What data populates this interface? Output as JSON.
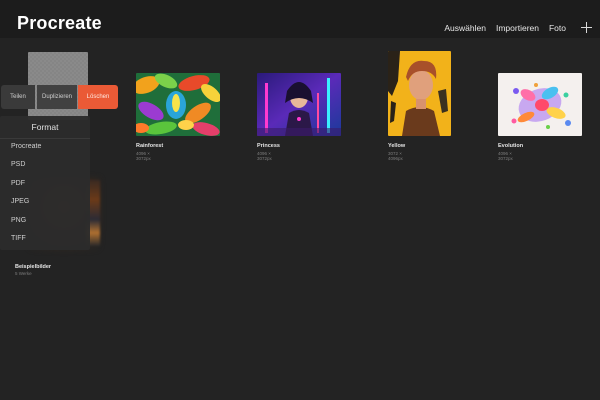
{
  "app": {
    "title": "Procreate"
  },
  "topnav": {
    "select": "Auswählen",
    "import": "Importieren",
    "photo": "Foto",
    "add_icon": "plus-icon"
  },
  "actions": {
    "share": "Teilen",
    "duplicate": "Duplizieren",
    "delete": "Löschen"
  },
  "format_menu": {
    "title": "Format",
    "items": [
      "Procreate",
      "PSD",
      "PDF",
      "JPEG",
      "PNG",
      "TIFF"
    ]
  },
  "stack": {
    "name": "Beispielbilder",
    "count": "5 Werke"
  },
  "artworks": [
    {
      "title": "Rainforest",
      "size": "4096 × 3072px"
    },
    {
      "title": "Princess",
      "size": "4096 × 3072px"
    },
    {
      "title": "Yellow",
      "size": "3072 × 4096px"
    },
    {
      "title": "Evolution",
      "size": "4096 × 3072px"
    }
  ],
  "colors": {
    "background": "#232323",
    "topbar": "#1c1c1c",
    "delete": "#ea5a36"
  }
}
